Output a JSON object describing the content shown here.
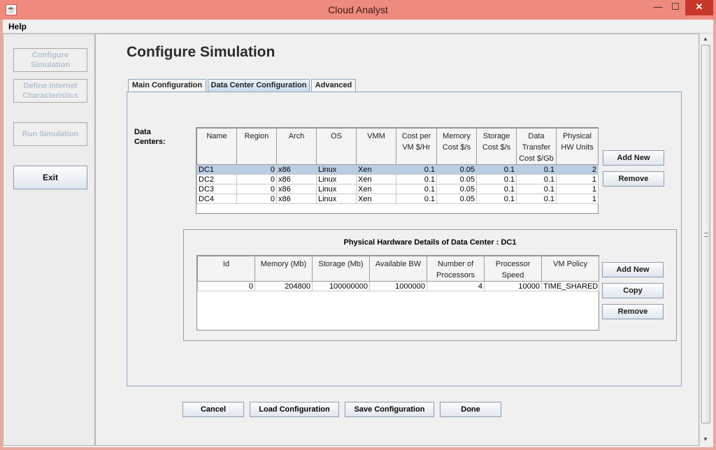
{
  "window": {
    "title": "Cloud Analyst",
    "min_glyph": "—",
    "max_glyph": "☐",
    "close_glyph": "✕"
  },
  "menu": {
    "help": "Help"
  },
  "nav": {
    "configure": "Configure Simulation",
    "internet": "Define Internet Characteristics",
    "run": "Run Simulation",
    "exit": "Exit"
  },
  "page": {
    "title": "Configure Simulation"
  },
  "tabs": [
    {
      "label": "Main Configuration"
    },
    {
      "label": "Data Center Configuration"
    },
    {
      "label": "Advanced"
    }
  ],
  "data_centers": {
    "label": "Data Centers:",
    "headers": [
      "Name",
      "Region",
      "Arch",
      "OS",
      "VMM",
      "Cost per VM $/Hr",
      "Memory Cost $/s",
      "Storage Cost $/s",
      "Data Transfer Cost $/Gb",
      "Physical HW Units"
    ],
    "rows": [
      [
        "DC1",
        "0",
        "x86",
        "Linux",
        "Xen",
        "0.1",
        "0.05",
        "0.1",
        "0.1",
        "2"
      ],
      [
        "DC2",
        "0",
        "x86",
        "Linux",
        "Xen",
        "0.1",
        "0.05",
        "0.1",
        "0.1",
        "1"
      ],
      [
        "DC3",
        "0",
        "x86",
        "Linux",
        "Xen",
        "0.1",
        "0.05",
        "0.1",
        "0.1",
        "1"
      ],
      [
        "DC4",
        "0",
        "x86",
        "Linux",
        "Xen",
        "0.1",
        "0.05",
        "0.1",
        "0.1",
        "1"
      ]
    ],
    "selected_row": 0,
    "add_new": "Add New",
    "remove": "Remove"
  },
  "hardware": {
    "title": "Physical Hardware Details of Data Center : DC1",
    "headers": [
      "Id",
      "Memory (Mb)",
      "Storage (Mb)",
      "Available BW",
      "Number of Processors",
      "Processor Speed",
      "VM Policy"
    ],
    "rows": [
      [
        "0",
        "204800",
        "100000000",
        "1000000",
        "4",
        "10000",
        "TIME_SHARED"
      ]
    ],
    "add_new": "Add New",
    "copy": "Copy",
    "remove": "Remove"
  },
  "actions": {
    "cancel": "Cancel",
    "load": "Load Configuration",
    "save": "Save Configuration",
    "done": "Done"
  }
}
